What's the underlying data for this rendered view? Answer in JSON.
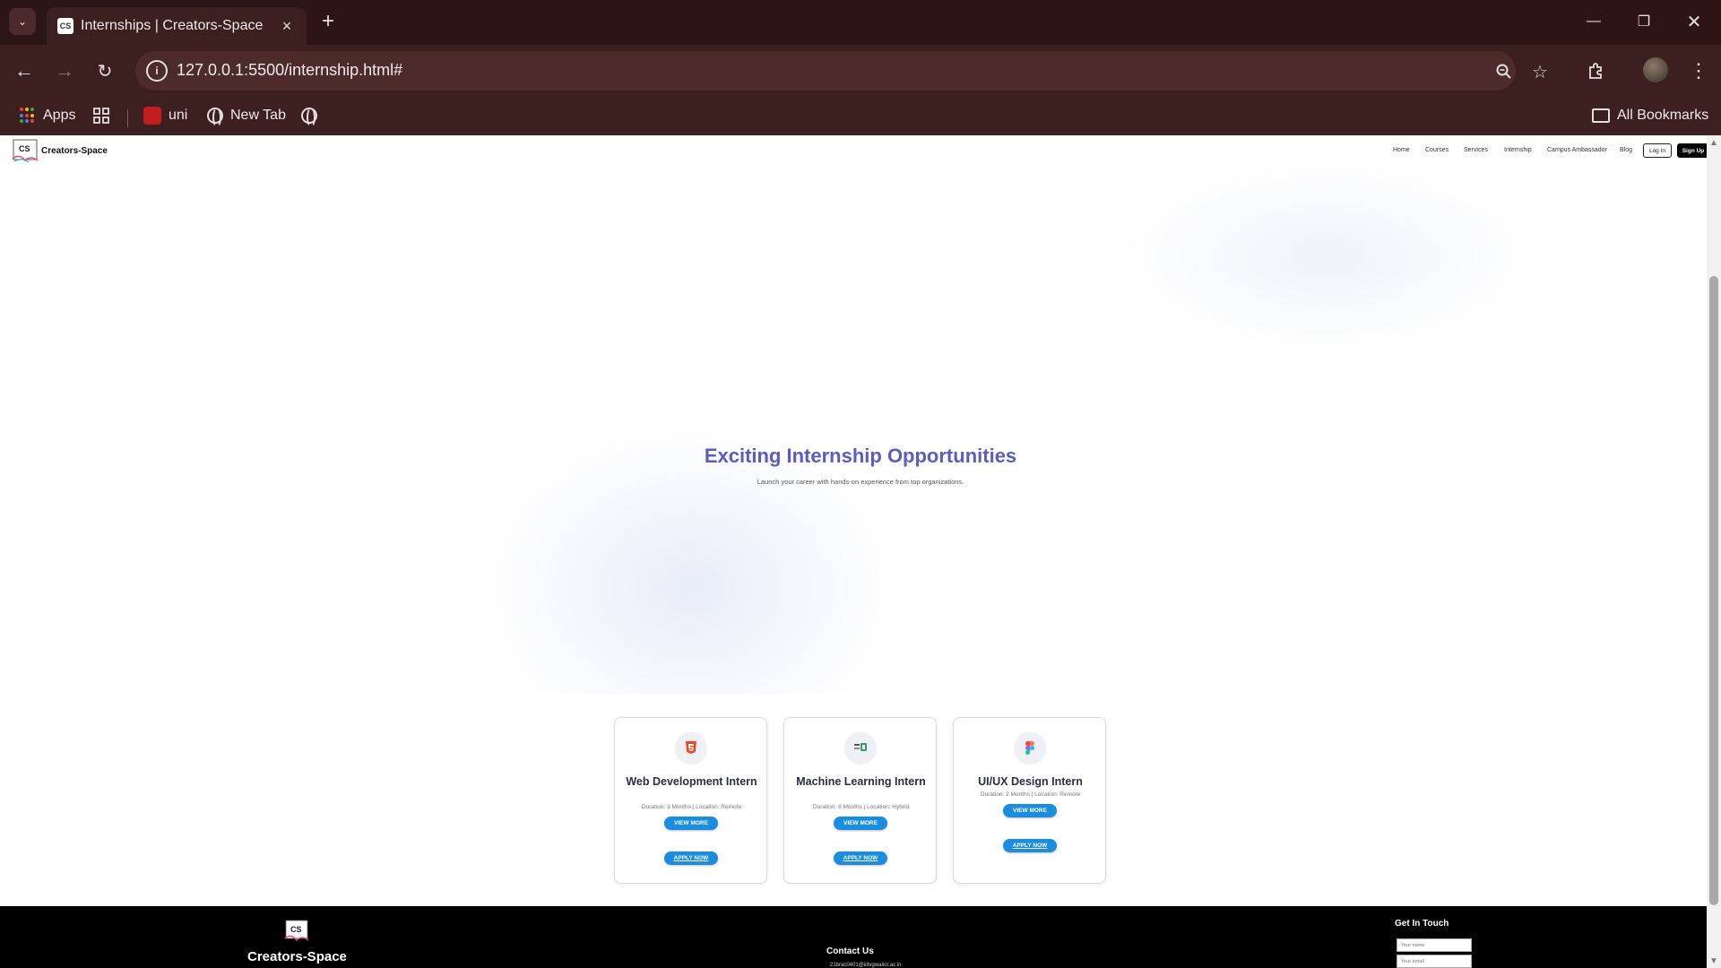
{
  "browser": {
    "tab_title": "Internships | Creators-Space",
    "url": "127.0.0.1:5500/internship.html#",
    "bookmarks": {
      "apps": "Apps",
      "uni": "uni",
      "new_tab": "New Tab",
      "all_bookmarks": "All Bookmarks"
    }
  },
  "site": {
    "brand": "Creators-Space",
    "nav": [
      "Home",
      "Courses",
      "Services",
      "Internship",
      "Campus Ambassador",
      "Blog"
    ],
    "login": "Log In",
    "signup": "Sign Up"
  },
  "hero": {
    "title": "Exciting Internship Opportunities",
    "subtitle": "Launch your career with hands-on experience from top organizations."
  },
  "internships": [
    {
      "title": "Web Development Intern",
      "meta": "Duration: 3 Months | Location: Remote",
      "view": "VIEW MORE",
      "apply": "APPLY NOW",
      "icon": "html5-icon"
    },
    {
      "title": "Machine Learning Intern",
      "meta": "Duration: 6 Months | Location: Hybrid",
      "view": "VIEW MORE",
      "apply": "APPLY NOW",
      "icon": "machine-learning-icon"
    },
    {
      "title": "UI/UX Design Intern",
      "meta": "Duration: 2 Months | Location: Remote",
      "view": "VIEW MORE",
      "apply": "APPLY NOW",
      "icon": "figma-icon"
    }
  ],
  "footer": {
    "brand": "Creators-Space",
    "contact_title": "Contact Us",
    "email": "21brac0401@iiitvgwalior.ac.in",
    "get_in_touch": "Get In Touch",
    "name_placeholder": "Your name",
    "email_placeholder": "Your email"
  },
  "colors": {
    "hero_title": "#5a5cc4",
    "button_blue": "#1a8de0",
    "chrome_bg": "#3c1f1f"
  }
}
